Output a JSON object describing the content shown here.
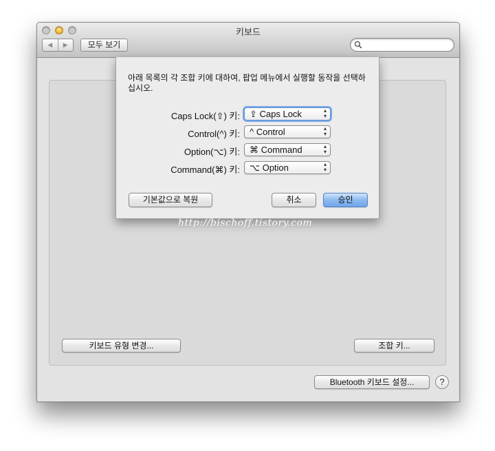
{
  "window": {
    "title": "키보드"
  },
  "toolbar": {
    "back_symbol": "◀",
    "forward_symbol": "▶",
    "show_all_label": "모두 보기",
    "search": {
      "value": "",
      "placeholder": ""
    }
  },
  "background_panel": {
    "change_keyboard_type_label": "키보드 유형 변경...",
    "modifier_keys_label": "조합 키...",
    "bluetooth_setup_label": "Bluetooth 키보드 설정...",
    "help_symbol": "?"
  },
  "sheet": {
    "message": "아래 목록의 각 조합 키에 대하여,  팝업 메뉴에서 실행할 동작을 선택하십시오.",
    "rows": [
      {
        "label": "Caps Lock(⇪) 키:",
        "value": "⇪ Caps Lock"
      },
      {
        "label": "Control(^) 키:",
        "value": "^ Control"
      },
      {
        "label": "Option(⌥) 키:",
        "value": "⌘ Command"
      },
      {
        "label": "Command(⌘) 키:",
        "value": "⌥ Option"
      }
    ],
    "restore_defaults_label": "기본값으로 복원",
    "cancel_label": "취소",
    "ok_label": "승인"
  },
  "watermark": "http://bischoff.tistory.com",
  "colors": {
    "close": "#f25a52",
    "minimize": "#f0bc36",
    "zoom": "#bdbdbd",
    "default_button": "#6fa6ea",
    "focus_ring": "#7aa8e6"
  }
}
